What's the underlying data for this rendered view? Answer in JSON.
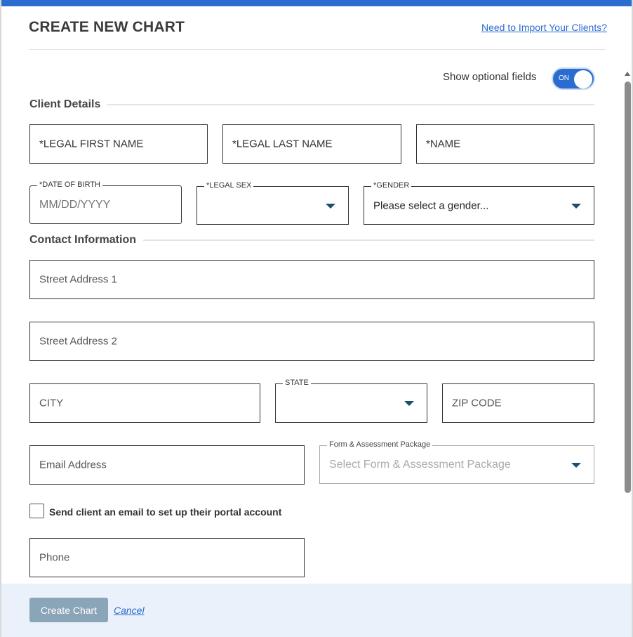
{
  "header": {
    "title": "CREATE NEW CHART",
    "import_link": "Need to Import Your Clients?"
  },
  "optional_toggle": {
    "label": "Show optional fields",
    "state": "ON"
  },
  "client_details": {
    "heading": "Client Details",
    "first_name_placeholder": "*LEGAL FIRST NAME",
    "last_name_placeholder": "*LEGAL LAST NAME",
    "name_placeholder": "*NAME",
    "dob_label": "*DATE OF BIRTH",
    "dob_placeholder": "MM/DD/YYYY",
    "legal_sex_label": "*LEGAL SEX",
    "legal_sex_value": "",
    "gender_label": "*GENDER",
    "gender_value": "Please select a gender..."
  },
  "contact_information": {
    "heading": "Contact Information",
    "street1_placeholder": "Street Address 1",
    "street2_placeholder": "Street Address 2",
    "city_placeholder": "CITY",
    "state_label": "STATE",
    "state_value": "",
    "zip_placeholder": "ZIP CODE",
    "email_placeholder": "Email Address",
    "package_label": "Form & Assessment Package",
    "package_placeholder": "Select Form & Assessment Package",
    "portal_checkbox_label": "Send client an email to set up their portal account",
    "portal_checkbox_checked": false,
    "phone_placeholder": "Phone"
  },
  "footer": {
    "create_label": "Create Chart",
    "cancel_label": "Cancel"
  },
  "colors": {
    "accent": "#2b6cd0",
    "caret": "#1d4e6e",
    "disabled_button": "#8aa5b8",
    "footer_bg": "#eaf1fa"
  }
}
